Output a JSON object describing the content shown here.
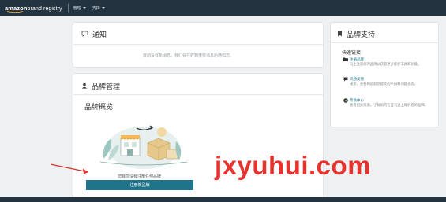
{
  "navbar": {
    "brand_prefix": "amazon",
    "brand_suffix": " brand registry",
    "menu_1": "管理",
    "menu_2": "支持"
  },
  "notifications": {
    "title": "通知",
    "icon": "message-icon",
    "empty_text": "目前没有新消息。我们会在收到重要消息后通知您。"
  },
  "brand_management": {
    "title": "品牌管理",
    "icon": "user-icon",
    "overview_title": "品牌概览",
    "cta_text": "您目前没有注册任何品牌",
    "cta_button": "注册新品牌"
  },
  "brand_support": {
    "title": "品牌支持",
    "icon": "bookmark-icon",
    "quick_links_label": "快速链接",
    "items": [
      {
        "icon": "folder-icon",
        "link": "注册品牌",
        "desc": "马上注册您的品牌以获取更多保护工具和功能。"
      },
      {
        "icon": "chat-icon",
        "link": "问题反馈",
        "desc": "搜索、查看和追踪您提交的举报和问题状态。"
      },
      {
        "icon": "help-icon",
        "link": "帮助中心",
        "desc": "查看相关资源，了解如何在亚马逊上保护您的品牌。"
      }
    ]
  },
  "watermark": "jxyuhui.com",
  "colors": {
    "navbar": "#23333f",
    "accent_teal": "#1f7489",
    "watermark_red": "#e8322d",
    "annotation_arrow": "#d9312b"
  }
}
